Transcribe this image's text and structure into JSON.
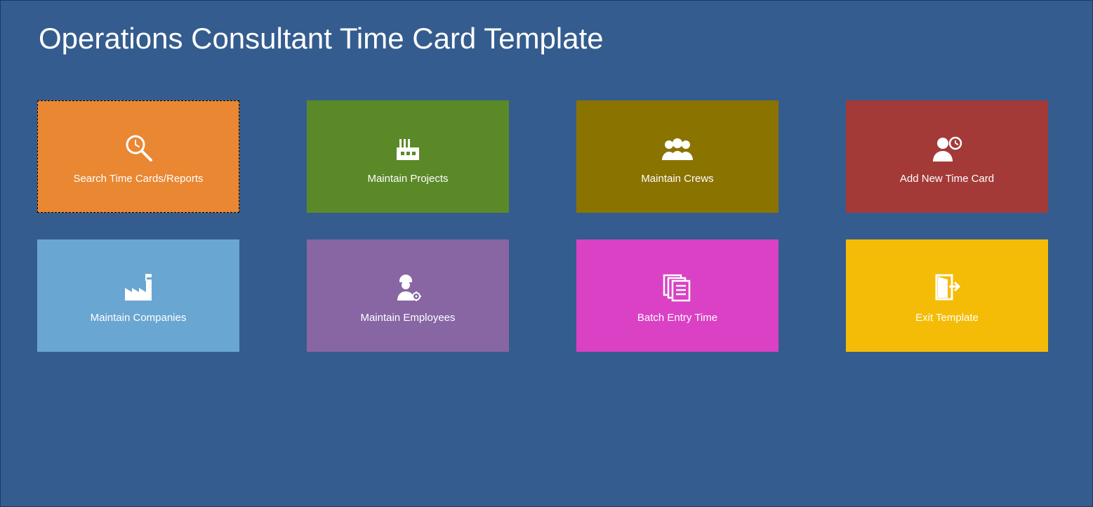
{
  "title": "Operations Consultant Time Card Template",
  "tiles": [
    {
      "label": "Search Time Cards/Reports",
      "color": "#e98732",
      "icon": "search-clock",
      "selected": true
    },
    {
      "label": "Maintain Projects",
      "color": "#5b8928",
      "icon": "factory-small",
      "selected": false
    },
    {
      "label": "Maintain Crews",
      "color": "#8b7300",
      "icon": "crew",
      "selected": false
    },
    {
      "label": "Add New Time Card",
      "color": "#a33a38",
      "icon": "person-clock",
      "selected": false
    },
    {
      "label": "Maintain Companies",
      "color": "#6aa6d2",
      "icon": "factory-flag",
      "selected": false
    },
    {
      "label": "Maintain Employees",
      "color": "#8766a3",
      "icon": "worker-gear",
      "selected": false
    },
    {
      "label": "Batch Entry Time",
      "color": "#da41c4",
      "icon": "documents",
      "selected": false
    },
    {
      "label": "Exit Template",
      "color": "#f4bc06",
      "icon": "exit",
      "selected": false
    }
  ]
}
